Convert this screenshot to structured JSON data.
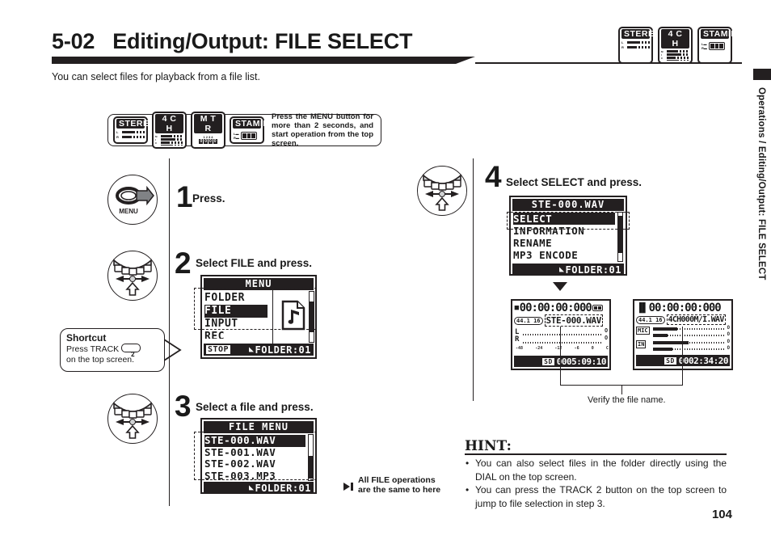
{
  "header": {
    "section_number": "5-02",
    "title": "Editing/Output: FILE SELECT",
    "intro": "You can select files for playback from a file list.",
    "badges": [
      {
        "label": "STEREO",
        "icon": "stereo-meter-icon"
      },
      {
        "label": "4 C H",
        "icon": "fourch-meter-icon"
      },
      {
        "label": "STAMINA",
        "icon": "battery-icon"
      }
    ]
  },
  "side_tab": {
    "text": "Operations / Editing/Output: FILE SELECT"
  },
  "page_number": "104",
  "note_box": {
    "badges": [
      {
        "label": "STEREO",
        "icon": "stereo-meter-icon"
      },
      {
        "label": "4 C H",
        "icon": "fourch-meter-icon"
      },
      {
        "label": "M T R",
        "icon": "mtr-track-icon"
      },
      {
        "label": "STAMINA",
        "icon": "battery-icon"
      }
    ],
    "text": "Press the MENU button for more than 2 seconds, and start operation from the top screen."
  },
  "steps": [
    {
      "number": "1",
      "instruction": "Press.",
      "knob_icon": "menu-button-icon",
      "knob_label": "MENU"
    },
    {
      "number": "2",
      "instruction": "Select FILE and press.",
      "knob_icon": "dial-updown-icon"
    },
    {
      "number": "3",
      "instruction": "Select a file and press.",
      "knob_icon": "dial-updown-icon"
    },
    {
      "number": "4",
      "instruction": "Select SELECT and press.",
      "knob_icon": "dial-updown-icon"
    }
  ],
  "screens": {
    "menu": {
      "title": "MENU",
      "items": [
        {
          "label": "FOLDER",
          "selected": false
        },
        {
          "label": "FILE",
          "selected": true
        },
        {
          "label": "INPUT",
          "selected": false
        },
        {
          "label": "REC",
          "selected": false
        }
      ],
      "icon": "music-file-icon",
      "footer_left": "STOP",
      "footer_right": "FOLDER:01",
      "footer_icon": "folder-icon"
    },
    "file_menu": {
      "title": "FILE MENU",
      "items": [
        {
          "label": "STE-000.WAV",
          "selected": true
        },
        {
          "label": "STE-001.WAV",
          "selected": false
        },
        {
          "label": "STE-002.WAV",
          "selected": false
        },
        {
          "label": "STE-003.MP3",
          "selected": false
        }
      ],
      "footer_right": "FOLDER:01",
      "footer_icon": "folder-icon"
    },
    "file_submenu": {
      "title": "STE-000.WAV",
      "items": [
        {
          "label": "SELECT",
          "selected": true
        },
        {
          "label": "INFORMATION",
          "selected": false
        },
        {
          "label": "RENAME",
          "selected": false
        },
        {
          "label": "MP3 ENCODE",
          "selected": false
        }
      ],
      "footer_right": "FOLDER:01",
      "footer_icon": "folder-icon"
    },
    "playback_stereo": {
      "transport_icon": "stop-icon",
      "timecode": "00:00:00:000",
      "battery_icon": "battery-icon",
      "format": "44.1 16",
      "filename": "STE-000.WAV",
      "meter_labels": [
        "L",
        "R"
      ],
      "scale": [
        "-48",
        "-24",
        "-12",
        "-6",
        "0",
        "C"
      ],
      "card_icon": "SD",
      "remain": "0005:09:10"
    },
    "playback_4ch": {
      "transport_icon": "pause-icon",
      "timecode": "00:00:00:000",
      "format": "44.1 16",
      "filename": "4CH000M/I.WAV",
      "meter_labels": [
        "MIC",
        "IN"
      ],
      "card_icon": "SD",
      "remain": "0002:34:20"
    }
  },
  "shortcut": {
    "title": "Shortcut",
    "line1_pre": "Press",
    "line1_key": "TRACK",
    "key_number": "2",
    "line2": "on the top screen."
  },
  "annotations": {
    "all_file_ops_line1": "All FILE operations",
    "all_file_ops_line2": "are the same to here",
    "all_file_ops_icon": "skip-forward-icon",
    "verify_caption": "Verify the file name."
  },
  "hint": {
    "heading": "HINT:",
    "bullets": [
      "You can also select files in the folder directly using the DIAL on the top screen.",
      "You can press the TRACK 2 button on the top screen to jump to file selection in step 3."
    ]
  }
}
